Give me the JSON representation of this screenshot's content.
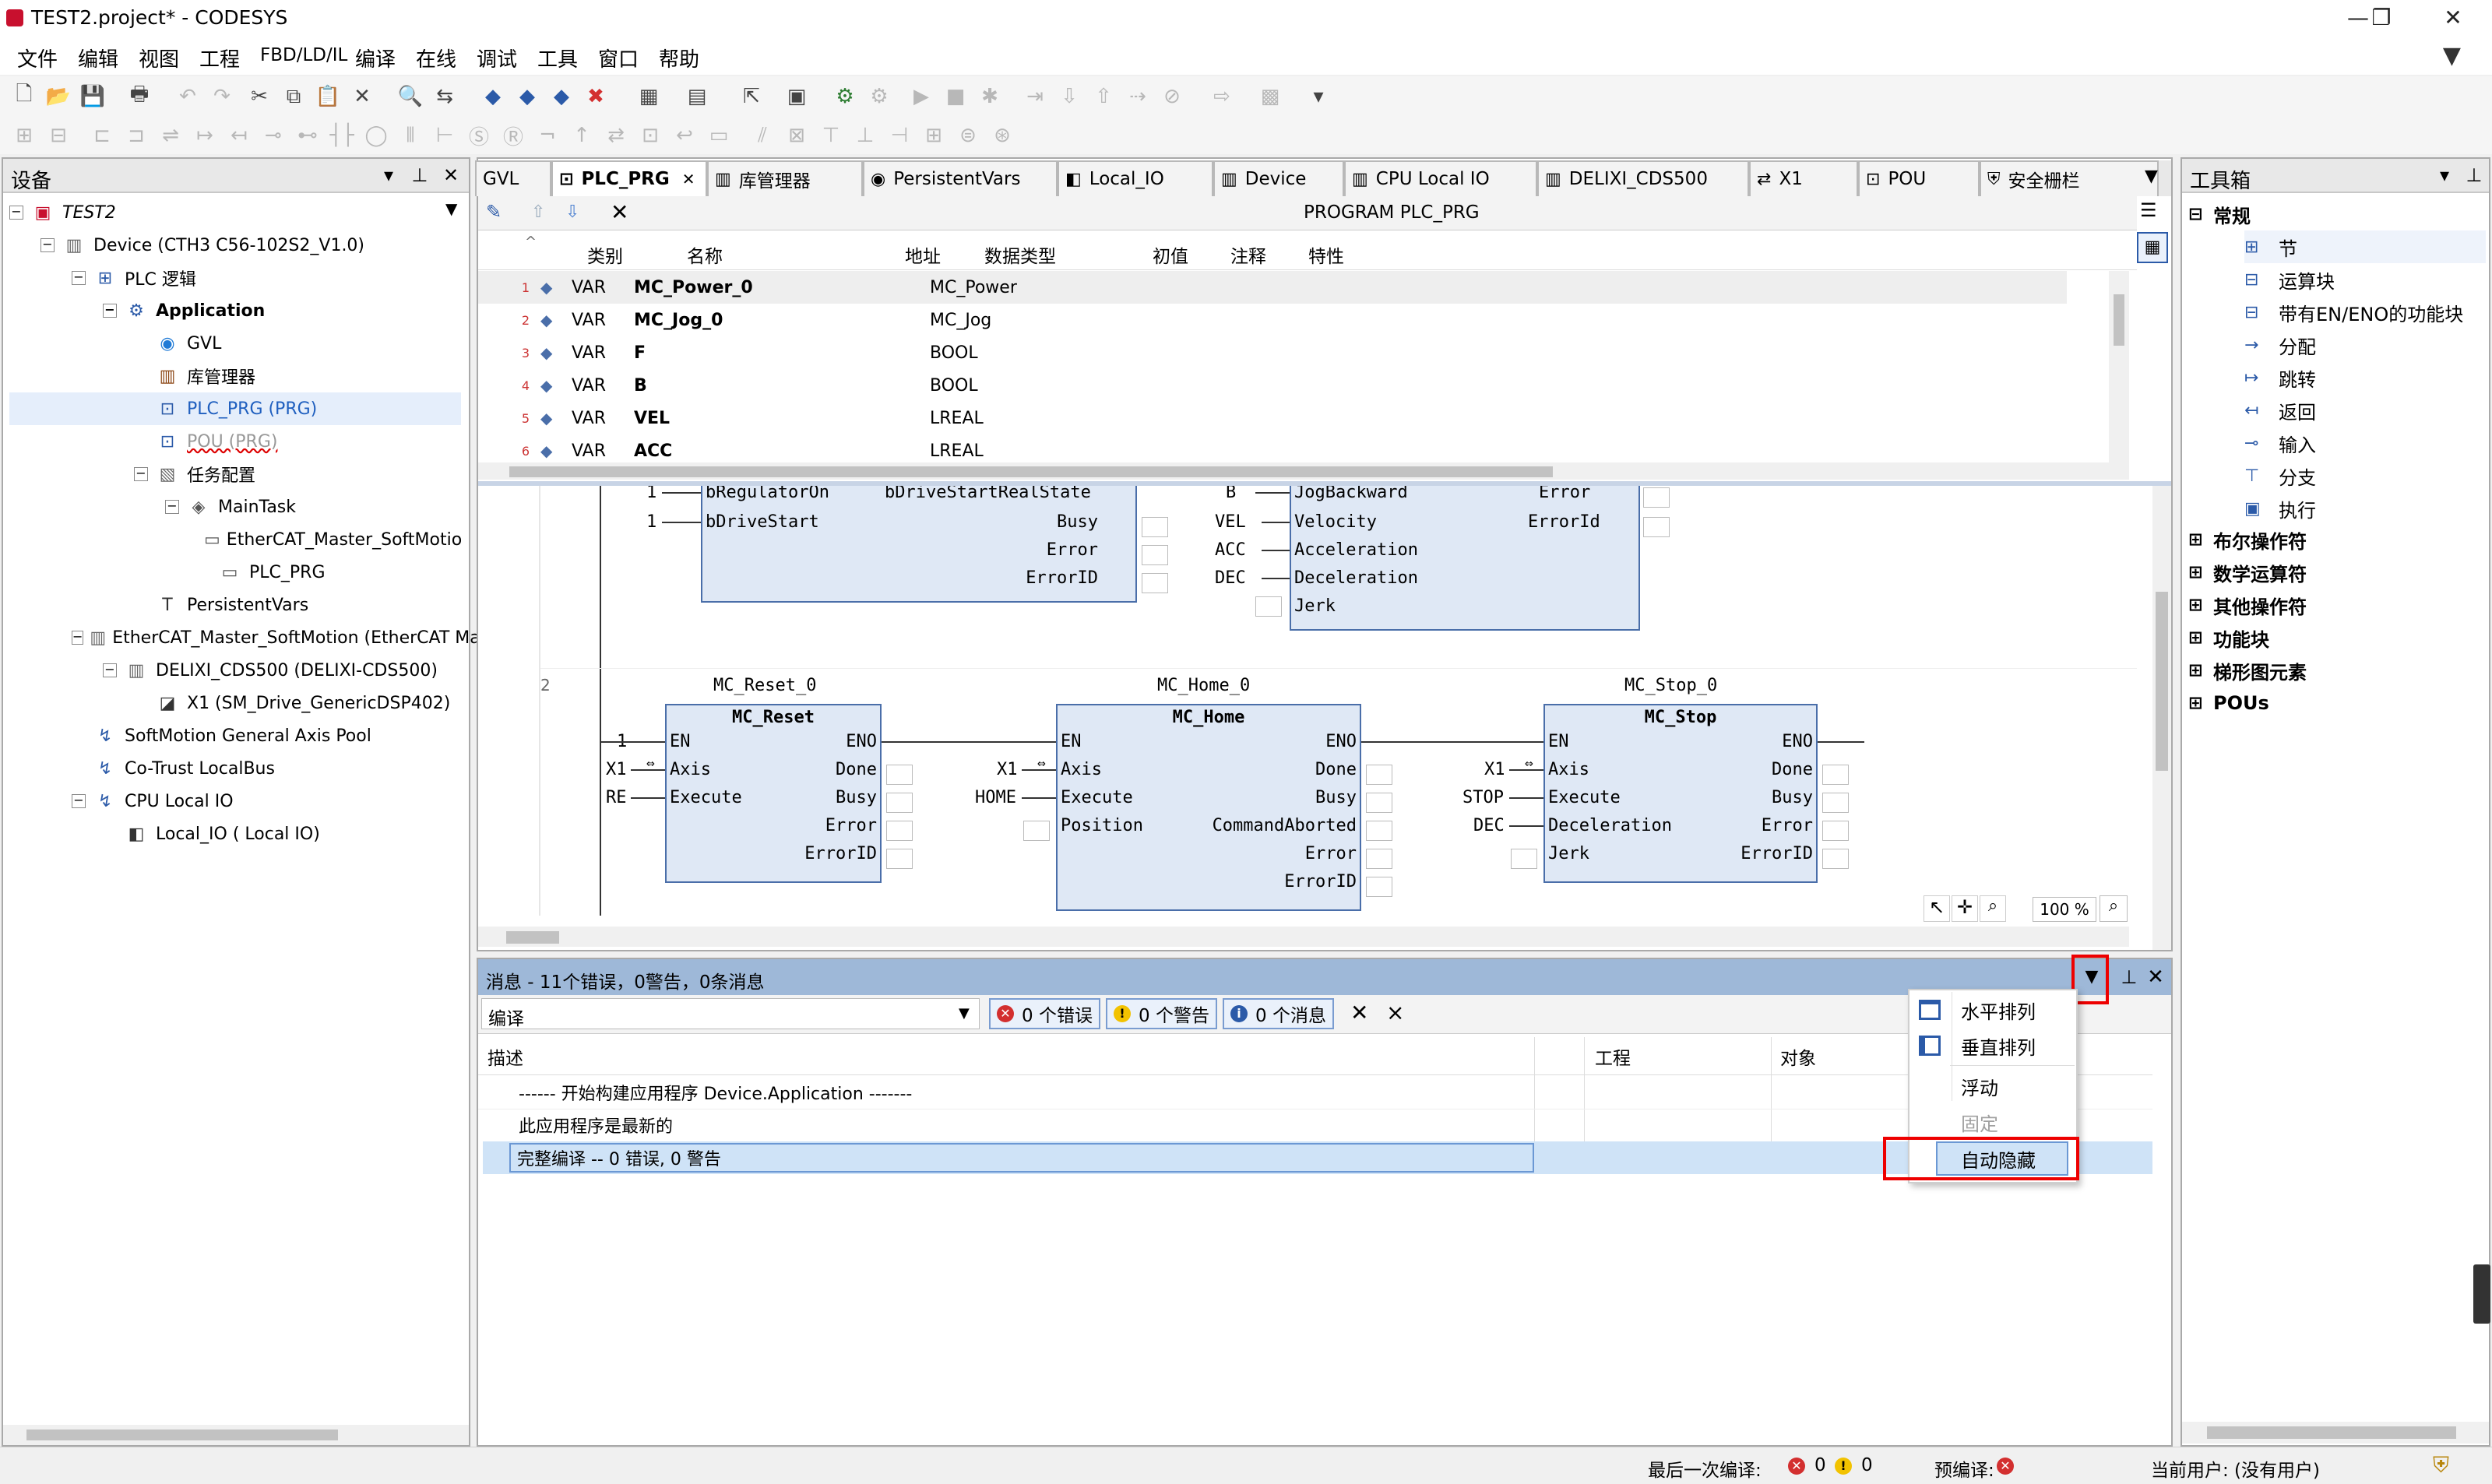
{
  "window": {
    "title": "TEST2.project* - CODESYS",
    "controls": [
      "—",
      "❐",
      "✕"
    ]
  },
  "menu": [
    "文件",
    "编辑",
    "视图",
    "工程",
    "FBD/LD/IL",
    "编译",
    "在线",
    "调试",
    "工具",
    "窗口",
    "帮助"
  ],
  "devices_panel": {
    "title": "设备",
    "tree": [
      {
        "label": "TEST2",
        "depth": 0,
        "icon": "project-icon",
        "italic": true
      },
      {
        "label": "Device (CTH3 C56-102S2_V1.0)",
        "depth": 1,
        "icon": "device-icon"
      },
      {
        "label": "PLC 逻辑",
        "depth": 2,
        "icon": "plc-logic-icon"
      },
      {
        "label": "Application",
        "depth": 3,
        "icon": "application-icon",
        "bold": true
      },
      {
        "label": "GVL",
        "depth": 4,
        "icon": "globe-icon"
      },
      {
        "label": "库管理器",
        "depth": 4,
        "icon": "library-icon"
      },
      {
        "label": "PLC_PRG (PRG)",
        "depth": 4,
        "icon": "pou-icon",
        "selected": true,
        "link": true
      },
      {
        "label": "POU (PRG)",
        "depth": 4,
        "icon": "pou-icon",
        "dim": true
      },
      {
        "label": "任务配置",
        "depth": 4,
        "icon": "task-config-icon"
      },
      {
        "label": "MainTask",
        "depth": 5,
        "icon": "task-icon"
      },
      {
        "label": "EtherCAT_Master_SoftMotio",
        "depth": 6,
        "icon": "call-icon"
      },
      {
        "label": "PLC_PRG",
        "depth": 6,
        "icon": "call-icon"
      },
      {
        "label": "PersistentVars",
        "depth": 4,
        "icon": "persistent-icon"
      },
      {
        "label": "EtherCAT_Master_SoftMotion (EtherCAT Mas",
        "depth": 2,
        "icon": "device-icon"
      },
      {
        "label": "DELIXI_CDS500 (DELIXI-CDS500)",
        "depth": 3,
        "icon": "device-icon"
      },
      {
        "label": "X1 (SM_Drive_GenericDSP402)",
        "depth": 4,
        "icon": "drive-icon"
      },
      {
        "label": "SoftMotion General Axis Pool",
        "depth": 2,
        "icon": "axis-pool-icon"
      },
      {
        "label": "Co-Trust LocalBus",
        "depth": 2,
        "icon": "axis-pool-icon"
      },
      {
        "label": "CPU Local IO",
        "depth": 2,
        "icon": "axis-pool-icon"
      },
      {
        "label": "Local_IO ( Local IO)",
        "depth": 3,
        "icon": "io-icon"
      }
    ]
  },
  "tabs": [
    {
      "label": "GVL"
    },
    {
      "label": "PLC_PRG",
      "active": true
    },
    {
      "label": "库管理器"
    },
    {
      "label": "PersistentVars"
    },
    {
      "label": "Local_IO"
    },
    {
      "label": "Device"
    },
    {
      "label": "CPU Local IO"
    },
    {
      "label": "DELIXI_CDS500"
    },
    {
      "label": "X1"
    },
    {
      "label": "POU"
    },
    {
      "label": "安全栅栏"
    }
  ],
  "editor": {
    "program_title": "PROGRAM PLC_PRG",
    "columns": [
      "类别",
      "名称",
      "地址",
      "数据类型",
      "初值",
      "注释",
      "特性"
    ],
    "vars": [
      {
        "line": "1",
        "kind": "VAR",
        "name": "MC_Power_0",
        "type": "MC_Power"
      },
      {
        "line": "2",
        "kind": "VAR",
        "name": "MC_Jog_0",
        "type": "MC_Jog"
      },
      {
        "line": "3",
        "kind": "VAR",
        "name": "F",
        "type": "BOOL"
      },
      {
        "line": "4",
        "kind": "VAR",
        "name": "B",
        "type": "BOOL"
      },
      {
        "line": "5",
        "kind": "VAR",
        "name": "VEL",
        "type": "LREAL"
      },
      {
        "line": "6",
        "kind": "VAR",
        "name": "ACC",
        "type": "LREAL"
      }
    ],
    "zoom": "100 %"
  },
  "fbd": {
    "net1": {
      "left_inputs": [
        "1",
        "1"
      ],
      "left_pins": [
        "bRegulatorOn",
        "bDriveStart"
      ],
      "left_outputs": [
        "bDriveStartRealState",
        "Busy",
        "Error",
        "ErrorID"
      ],
      "mid_inputs": [
        "B",
        "VEL",
        "ACC",
        "DEC"
      ],
      "mid_pins": [
        "JogBackward",
        "Velocity",
        "Acceleration",
        "Deceleration",
        "Jerk"
      ],
      "mid_outputs": [
        "Error",
        "ErrorId"
      ]
    },
    "net2_number": "2",
    "reset": {
      "instance": "MC_Reset_0",
      "type": "MC_Reset",
      "inputs": [
        "EN",
        "Axis",
        "Execute"
      ],
      "outputs": [
        "ENO",
        "Done",
        "Busy",
        "Error",
        "ErrorID"
      ],
      "vars": [
        "1",
        "X1",
        "RE"
      ]
    },
    "home": {
      "instance": "MC_Home_0",
      "type": "MC_Home",
      "inputs": [
        "EN",
        "Axis",
        "Execute",
        "Position"
      ],
      "outputs": [
        "ENO",
        "Done",
        "Busy",
        "CommandAborted",
        "Error",
        "ErrorID"
      ],
      "vars": [
        "X1",
        "HOME"
      ]
    },
    "stop": {
      "instance": "MC_Stop_0",
      "type": "MC_Stop",
      "inputs": [
        "EN",
        "Axis",
        "Execute",
        "Deceleration",
        "Jerk"
      ],
      "outputs": [
        "ENO",
        "Done",
        "Busy",
        "Error",
        "ErrorID"
      ],
      "vars": [
        "X1",
        "STOP",
        "DEC"
      ]
    }
  },
  "messages": {
    "title": "消息 - 11个错误，0警告，0条消息",
    "source": "编译",
    "filters": {
      "errors": "0 个错误",
      "warnings": "0 个警告",
      "info": "0 个消息"
    },
    "columns": [
      "描述",
      "工程",
      "对象"
    ],
    "rows": [
      "------ 开始构建应用程序 Device.Application -------",
      "此应用程序是最新的",
      "完整编译 -- 0 错误, 0 警告"
    ]
  },
  "context_menu": {
    "items": [
      "水平排列",
      "垂直排列",
      "浮动",
      "固定",
      "自动隐藏"
    ]
  },
  "toolbox": {
    "title": "工具箱",
    "general": "常规",
    "general_items": [
      "节",
      "运算块",
      "带有EN/ENO的功能块",
      "分配",
      "跳转",
      "返回",
      "输入",
      "分支",
      "执行"
    ],
    "groups": [
      "布尔操作符",
      "数学运算符",
      "其他操作符",
      "功能块",
      "梯形图元素",
      "POUs"
    ]
  },
  "status": {
    "last_compile_label": "最后一次编译:",
    "last_errors": "0",
    "last_warnings": "0",
    "precompile_label": "预编译:",
    "current_user": "当前用户: (没有用户)"
  },
  "colors": {
    "accent_blue": "#2b5aa8",
    "selection": "#cfe3f7",
    "error_red": "#d32f2f",
    "warning_yellow": "#f2c200",
    "highlight_red": "#ee0000"
  }
}
